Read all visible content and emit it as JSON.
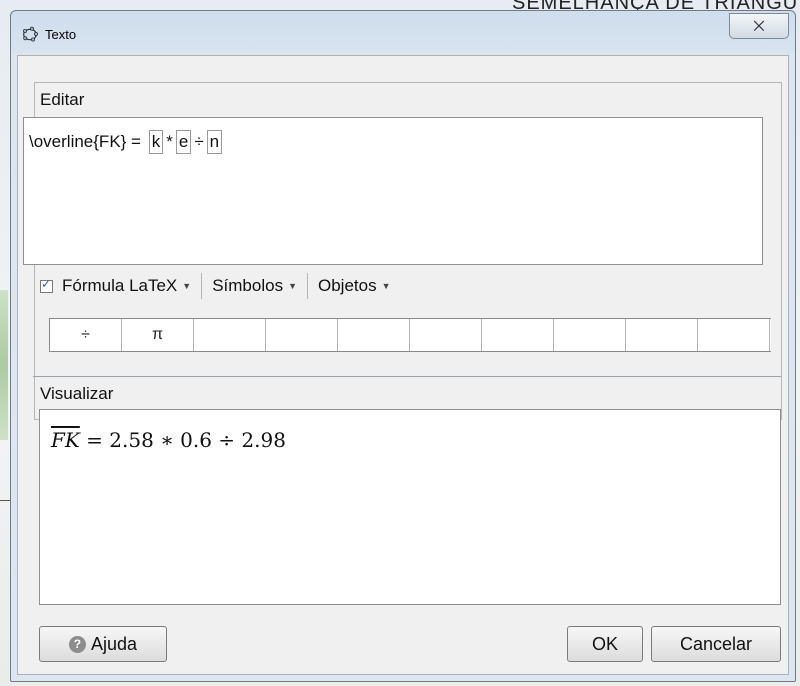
{
  "background": {
    "title_fragment": "SEMELHANÇA DE TRIANGU"
  },
  "dialog": {
    "title": "Texto",
    "close_glyph": "⨉"
  },
  "editor": {
    "label": "Editar",
    "content_prefix": "\\overline{FK} = ",
    "slots": [
      "k",
      "e",
      "n"
    ],
    "op1": "*",
    "op2": "÷"
  },
  "toolbar": {
    "latex_label": "Fórmula LaTeX",
    "latex_checked": true,
    "symbols_label": "Símbolos",
    "objects_label": "Objetos"
  },
  "symbols": [
    "÷",
    "π",
    "",
    "",
    "",
    "",
    "",
    "",
    "",
    ""
  ],
  "preview": {
    "label": "Visualizar",
    "lhs": "FK",
    "rhs": " = 2.58 ∗ 0.6 ÷ 2.98"
  },
  "buttons": {
    "help": "Ajuda",
    "ok": "OK",
    "cancel": "Cancelar"
  }
}
